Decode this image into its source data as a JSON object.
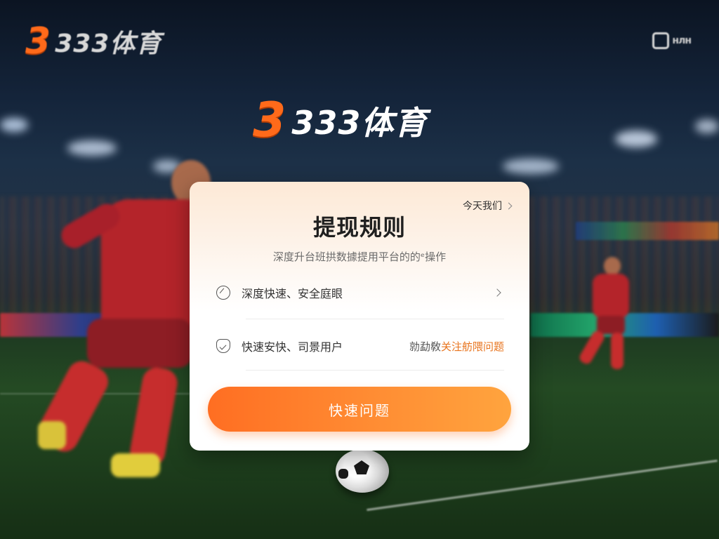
{
  "brand": {
    "mark": "3",
    "name": "333体育",
    "accent_color": "#ff6a1a"
  },
  "top_right": {
    "icon": "badge-icon",
    "text": "нлн"
  },
  "card": {
    "top_link": "今天我们",
    "title": "提现规则",
    "subtitle": "深度升台班拱数據提用平台的的ᵉ操作",
    "rows": [
      {
        "icon": "compass-icon",
        "label": "深度快速、安全庭眼",
        "hint": "",
        "hint_accent": ""
      },
      {
        "icon": "shield-icon",
        "label": "快速安快、司景用户",
        "hint": "勍勐敎",
        "hint_accent": "关注舫隈问题"
      }
    ],
    "cta_label": "快速问题",
    "cta_gradient": [
      "#ff6e22",
      "#ffa43e"
    ]
  }
}
